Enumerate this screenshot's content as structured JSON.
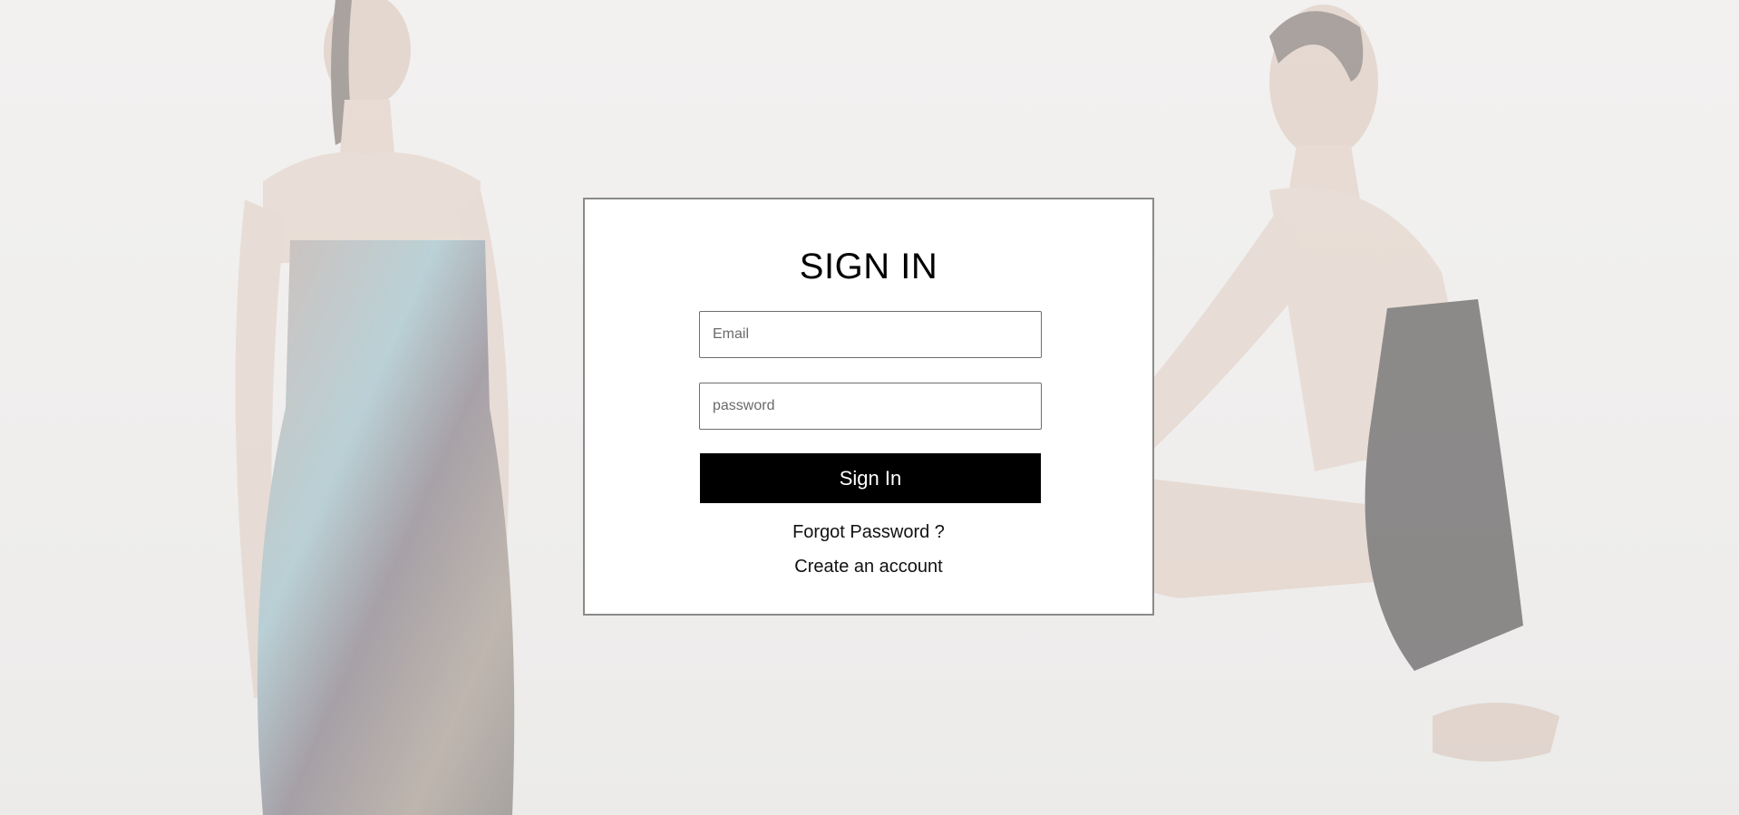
{
  "login": {
    "title": "SIGN IN",
    "email": {
      "value": "",
      "placeholder": "Email"
    },
    "password": {
      "value": "",
      "placeholder": "password"
    },
    "submit_label": "Sign In",
    "forgot_label": "Forgot Password ?",
    "create_label": "Create an account"
  },
  "colors": {
    "background": "#f0efee",
    "panel": "#ffffff",
    "panel_border": "#8a8a8a",
    "button": "#000000",
    "button_text": "#ffffff"
  }
}
